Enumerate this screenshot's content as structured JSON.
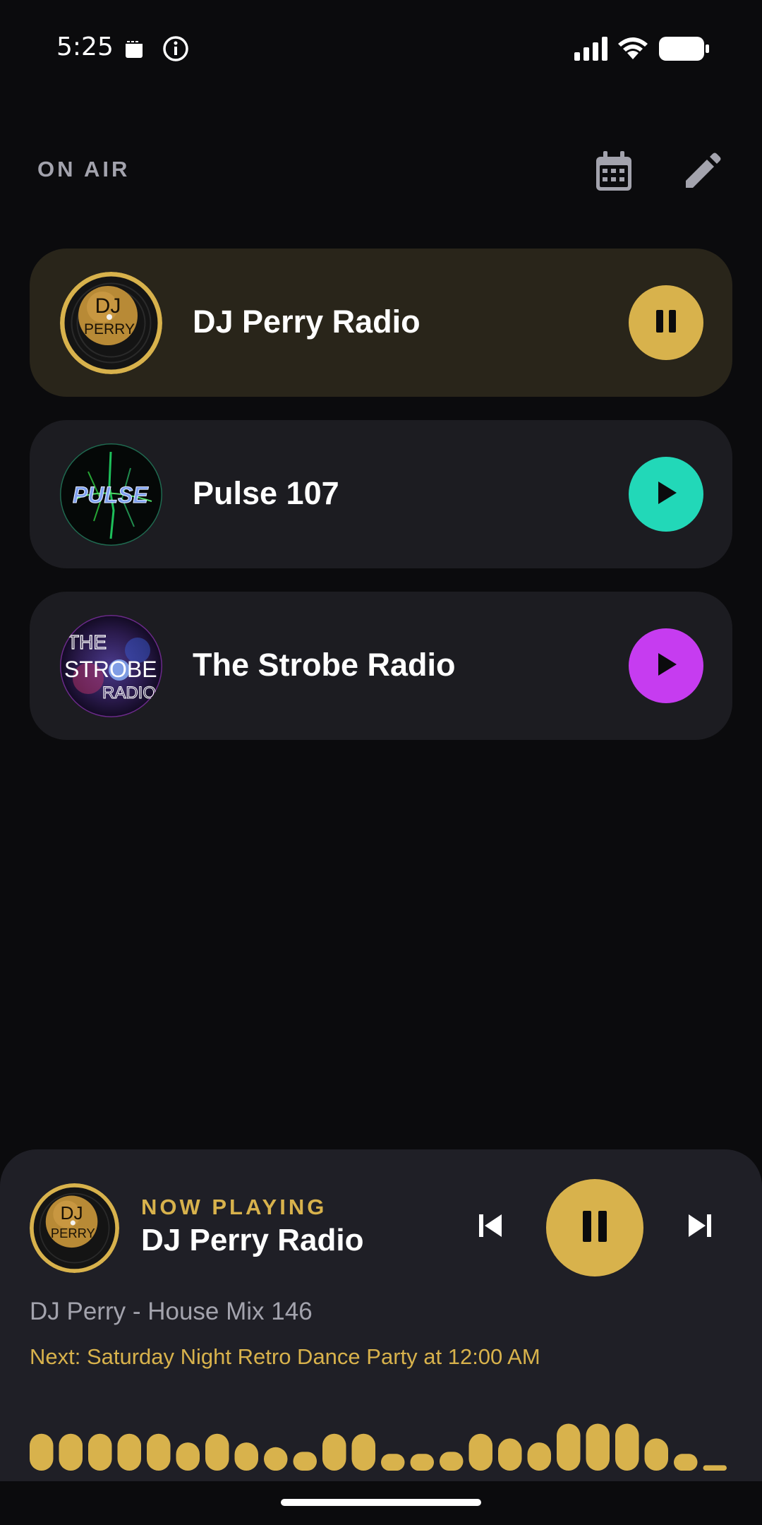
{
  "status_bar": {
    "time": "5:25",
    "icons": [
      "sim-card-icon",
      "info-icon",
      "signal-icon",
      "wifi-icon",
      "battery-icon"
    ]
  },
  "header": {
    "title": "ON AIR",
    "icons": [
      "calendar-icon",
      "pencil-icon"
    ]
  },
  "stations": [
    {
      "name": "DJ Perry Radio",
      "logo_text": [
        "DJ",
        "PERRY"
      ],
      "accent": "#d8b24c",
      "state": "playing",
      "control_icon": "pause-icon"
    },
    {
      "name": "Pulse 107",
      "logo_text": [
        "PULSE"
      ],
      "accent": "#22d8b8",
      "state": "stopped",
      "control_icon": "play-icon"
    },
    {
      "name": "The Strobe Radio",
      "logo_text": [
        "THE",
        "STROBE",
        "RADIO"
      ],
      "accent": "#c63cf0",
      "state": "stopped",
      "control_icon": "play-icon"
    }
  ],
  "now_playing": {
    "label": "NOW PLAYING",
    "station": "DJ Perry Radio",
    "logo_text": [
      "DJ",
      "PERRY"
    ],
    "track": "DJ Perry - House Mix 146",
    "next": "Next: Saturday Night Retro Dance Party at 12:00 AM",
    "accent": "#d8b24c",
    "controls": [
      "skip-previous-icon",
      "pause-icon",
      "skip-next-icon"
    ],
    "visualizer_levels": [
      0.55,
      0.55,
      0.55,
      0.55,
      0.55,
      0.42,
      0.55,
      0.42,
      0.35,
      0.28,
      0.55,
      0.55,
      0.25,
      0.25,
      0.28,
      0.55,
      0.48,
      0.42,
      0.7,
      0.7,
      0.7,
      0.48,
      0.25,
      0.08
    ]
  }
}
